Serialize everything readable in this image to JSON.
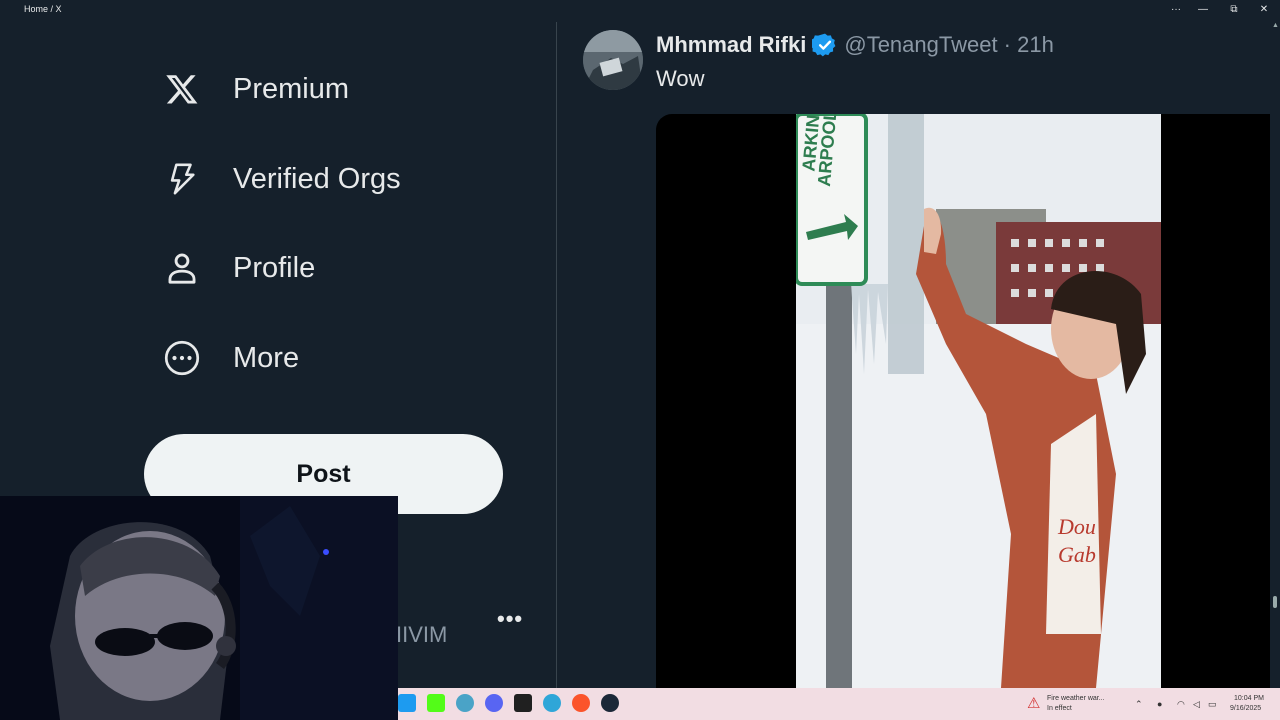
{
  "window": {
    "title": "Home / X",
    "controls": {
      "more": "···",
      "minimize": "—",
      "restore": "⧉",
      "close": "✕"
    }
  },
  "sidebar": {
    "items": [
      {
        "label": "Premium",
        "icon": "x-logo-icon"
      },
      {
        "label": "Verified Orgs",
        "icon": "lightning-icon"
      },
      {
        "label": "Profile",
        "icon": "person-icon"
      },
      {
        "label": "More",
        "icon": "more-circle-icon"
      }
    ],
    "post_label": "Post",
    "account_fragment": "IIVIM",
    "account_more": "•••"
  },
  "tweet": {
    "name": "Mhmmad Rifki",
    "handle_time": "@TenangTweet · 21h",
    "text": "Wow",
    "verified_color": "#1d9bf0",
    "sign_text_1": "ARKING",
    "sign_text_2": "ARPOOL",
    "shirt_text_1": "Dou",
    "shirt_text_2": "Gab"
  },
  "taskbar": {
    "weather_line1": "Fire weather war...",
    "weather_line2": "In effect",
    "time": "10:04 PM",
    "date": "9/16/2025",
    "apps": [
      "twitter-icon",
      "kick-icon",
      "snipping-icon",
      "discord-icon",
      "terminal-icon",
      "edge-icon",
      "brave-icon",
      "steam-icon"
    ]
  },
  "colors": {
    "background": "#15202b",
    "post_button": "#eff3f4",
    "taskbar": "#f2dde3",
    "accent": "#1d9bf0"
  }
}
